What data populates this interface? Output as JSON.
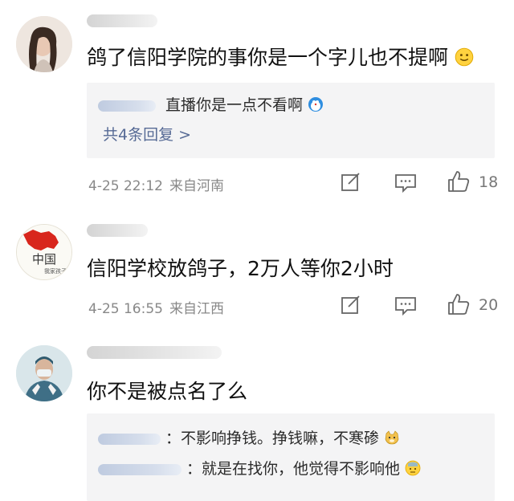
{
  "comments": [
    {
      "text": "鸽了信阳学院的事你是一个字儿也不提啊",
      "emoji": "smile-emoji",
      "replies": [
        {
          "text": "直播你是一点不看啊",
          "emoji": "doraemon-emoji"
        }
      ],
      "more_replies": "共4条回复 >",
      "time": "4-25 22:12",
      "location": "来自河南"
    },
    {
      "text": "信阳学校放鸽子，2万人等你2小时",
      "avatar_text": "中国",
      "avatar_subtext": "我家孩子",
      "time": "4-25 16:55",
      "location": "来自江西",
      "likes": "20"
    },
    {
      "text": "你不是被点名了么",
      "replies": [
        {
          "text": "：不影响挣钱。挣钱嘛，不寒碜",
          "emoji": "doge-emoji"
        },
        {
          "text": "：就是在找你，他觉得不影响他",
          "emoji": "sweat-emoji"
        }
      ]
    }
  ],
  "likes_first": "18",
  "colors": {
    "link": "#566a95",
    "reply_bg": "#f4f4f5",
    "meta": "#888888"
  }
}
